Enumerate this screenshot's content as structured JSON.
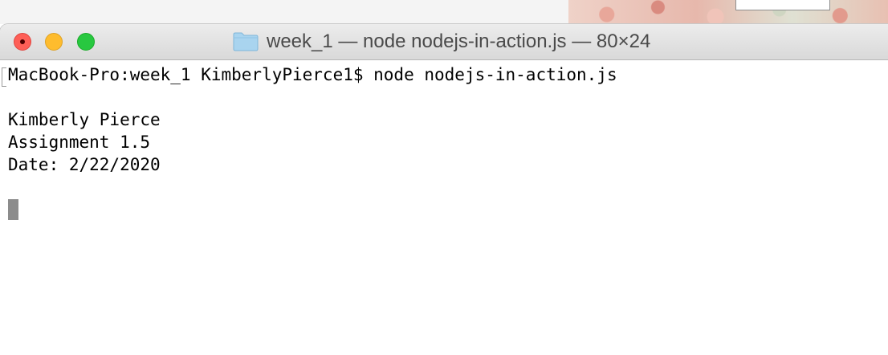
{
  "window": {
    "title": "week_1 — node nodejs-in-action.js — 80×24",
    "title_icon": "folder-icon",
    "buttons": {
      "close": "close-icon",
      "minimize": "minimize-icon",
      "maximize": "maximize-icon"
    }
  },
  "terminal": {
    "prompt_line": "MacBook-Pro:week_1 KimberlyPierce1$ node nodejs-in-action.js",
    "output": [
      "Kimberly Pierce",
      "Assignment 1.5",
      "Date: 2/22/2020"
    ]
  },
  "colors": {
    "close": "#fe5f57",
    "minimize": "#febc2e",
    "maximize": "#28c840",
    "folder": "#a9d4ef",
    "cursor": "#8c8c8c"
  }
}
